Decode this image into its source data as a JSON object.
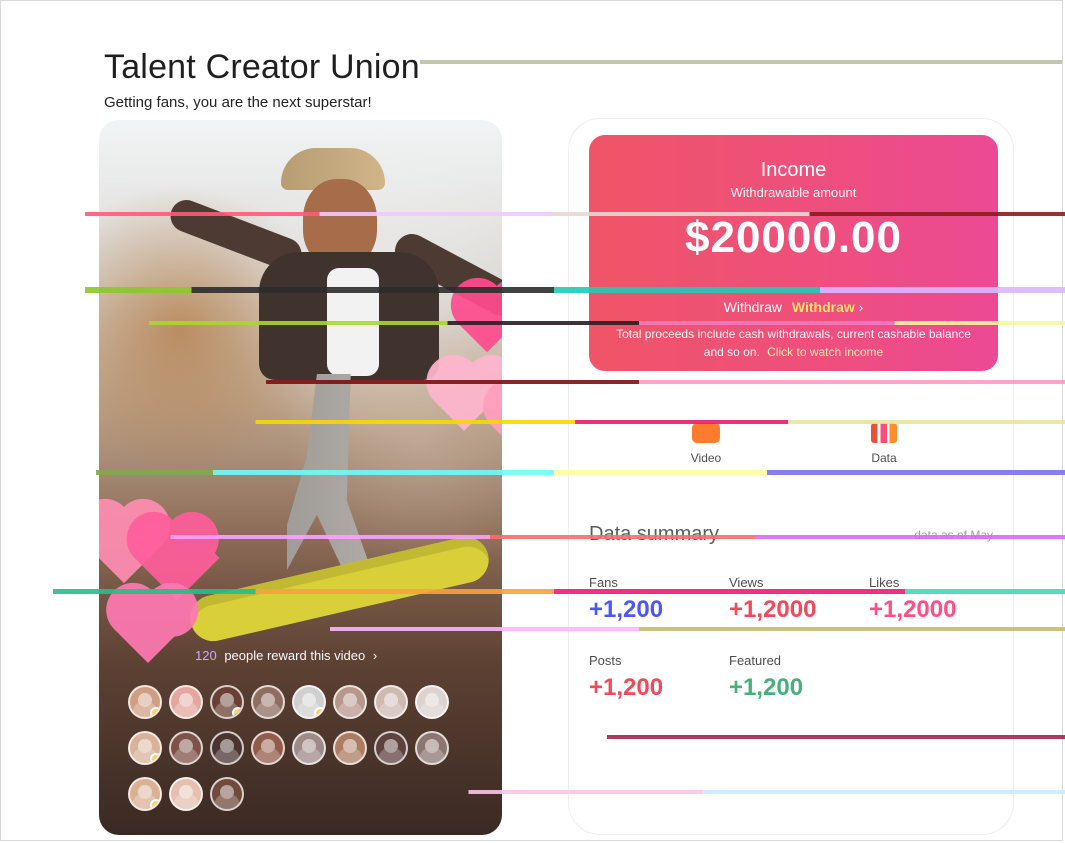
{
  "page": {
    "title": "Talent Creator Union",
    "subtitle": "Getting fans, you are the next superstar!"
  },
  "hero": {
    "reward_count": "120",
    "reward_text": "people reward this video",
    "hearts": [
      "#ff8db3",
      "#ff5e9a",
      "#ff79b2",
      "#ffb6cf",
      "#ff4c8e",
      "#ff9fbe"
    ],
    "avatar_badges": [
      "gold-badge",
      "gold-badge",
      "gold-badge",
      "gold-badge",
      "gold-badge"
    ]
  },
  "income": {
    "title": "Income",
    "withdrawable_label": "Withdrawable amount",
    "amount": "$20000.00",
    "withdraw_text": "Withdraw",
    "withdraw_link": "Withdraw",
    "note_text": "Total proceeds include cash withdrawals, current cashable balance and so on.",
    "note_link": "Click to watch income"
  },
  "media_switch": {
    "video_label": "Video",
    "data_label": "Data"
  },
  "summary": {
    "title": "Data summary",
    "date": "data as of May"
  },
  "stats": {
    "row1": [
      {
        "label": "Fans",
        "value": "+1,200"
      },
      {
        "label": "Views",
        "value": "+1,2000"
      },
      {
        "label": "Likes",
        "value": "+1,2000"
      }
    ],
    "row2": [
      {
        "label": "Posts",
        "value": "+1,200"
      },
      {
        "label": "Featured",
        "value": "+1,200"
      },
      {
        "label": "",
        "value": ""
      }
    ]
  },
  "colors": {
    "income_gradient_start": "#ef5567",
    "income_gradient_end": "#ec4a94",
    "withdraw_link": "#ffe268",
    "fans_value": "#4d57f5",
    "views_value": "#f2485b",
    "likes_value": "#ff4f86",
    "posts_value": "#f2485b",
    "featured_value": "#46b07c"
  }
}
